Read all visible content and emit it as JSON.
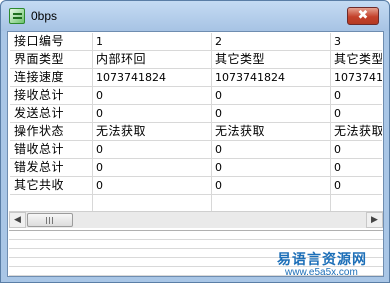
{
  "window": {
    "title": "0bps",
    "close_glyph": "✖"
  },
  "grid": {
    "columns": [
      "",
      "1",
      "2",
      "3"
    ],
    "rows": [
      {
        "label": "接口编号",
        "values": [
          "1",
          "2",
          "3"
        ]
      },
      {
        "label": "界面类型",
        "values": [
          "内部环回",
          "其它类型",
          "其它类型"
        ]
      },
      {
        "label": "连接速度",
        "values": [
          "1073741824",
          "1073741824",
          "1073741824"
        ]
      },
      {
        "label": "接收总计",
        "values": [
          "0",
          "0",
          "0"
        ]
      },
      {
        "label": "发送总计",
        "values": [
          "0",
          "0",
          "0"
        ]
      },
      {
        "label": "操作状态",
        "values": [
          "无法获取",
          "无法获取",
          "无法获取"
        ]
      },
      {
        "label": "错收总计",
        "values": [
          "0",
          "0",
          "0"
        ]
      },
      {
        "label": "错发总计",
        "values": [
          "0",
          "0",
          "0"
        ]
      },
      {
        "label": "其它共收",
        "values": [
          "0",
          "0",
          "0"
        ]
      }
    ]
  },
  "scrollbar": {
    "left_arrow": "◀",
    "right_arrow": "▶"
  },
  "watermark": {
    "brand": "易语言资源网",
    "url": "www.e5a5x.com"
  },
  "colors": {
    "title_bar": "#b7d1ee",
    "close_button": "#c4412b",
    "watermark": "#1d6fb8"
  }
}
